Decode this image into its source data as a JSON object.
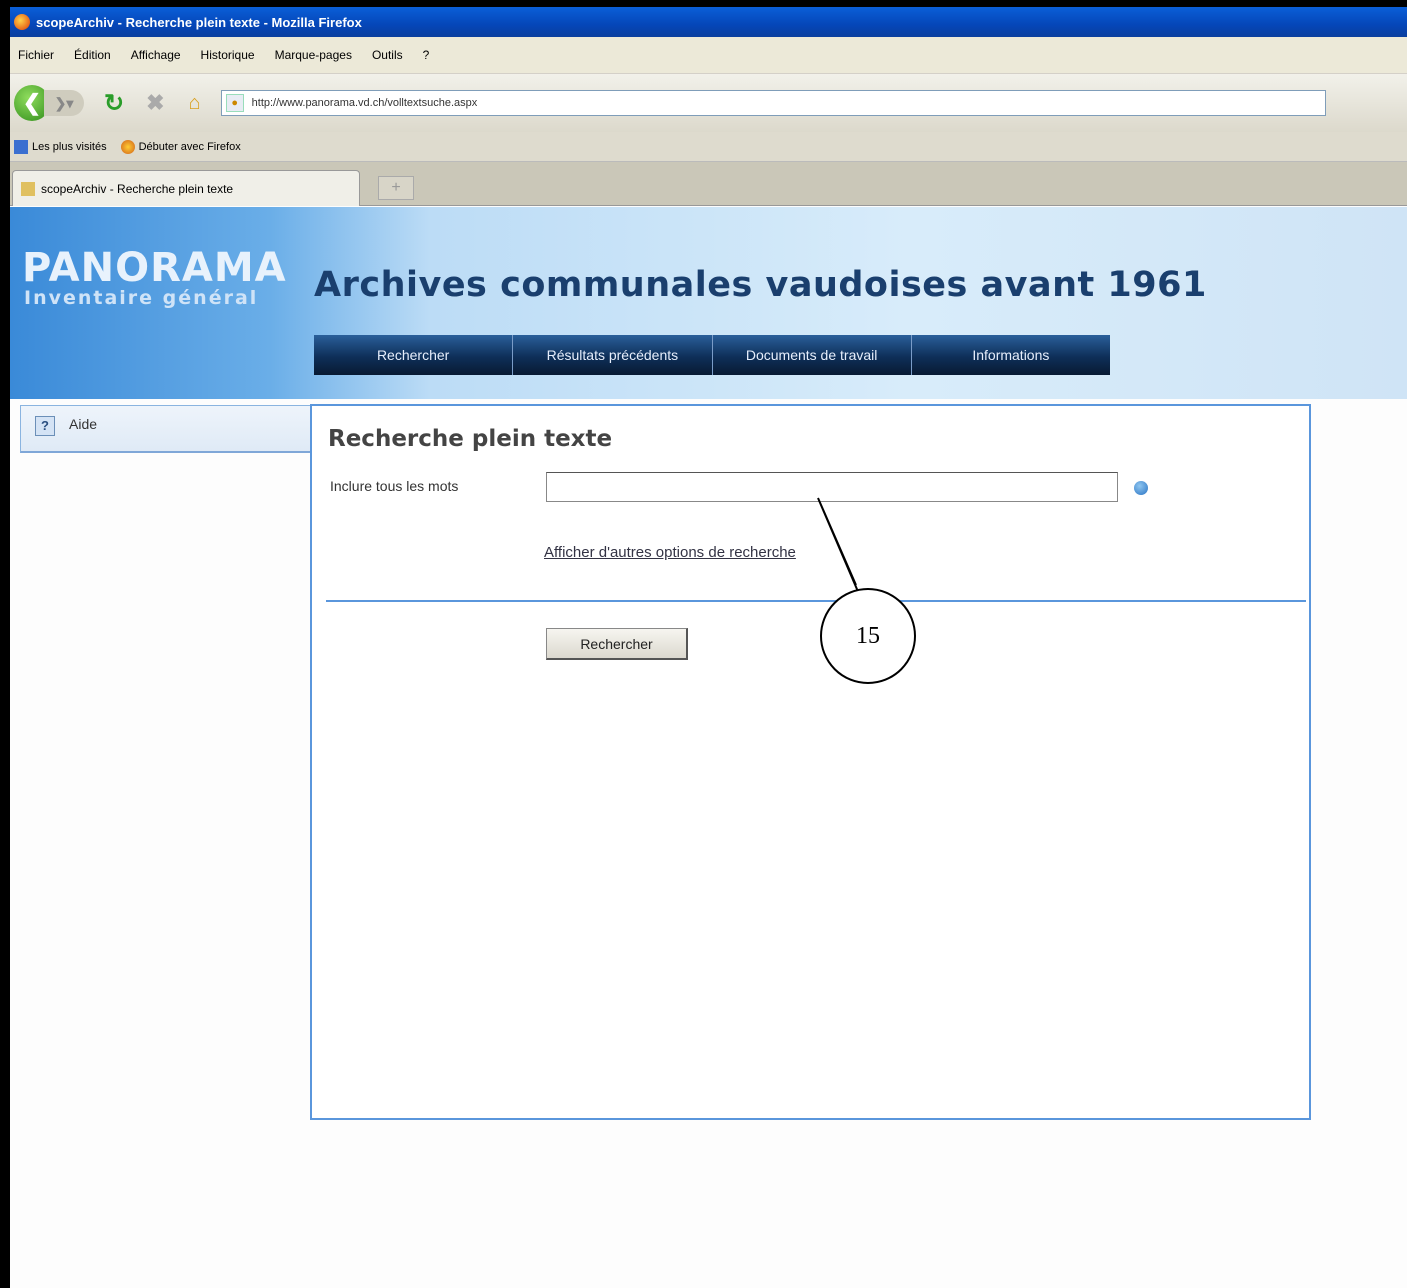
{
  "window": {
    "title": "scopeArchiv - Recherche plein texte - Mozilla Firefox"
  },
  "menu": [
    "Fichier",
    "Édition",
    "Affichage",
    "Historique",
    "Marque-pages",
    "Outils",
    "?"
  ],
  "navbar": {
    "url": "http://www.panorama.vd.ch/volltextsuche.aspx"
  },
  "bookmarks": [
    "Les plus visités",
    "Débuter avec Firefox"
  ],
  "tab": {
    "label": "scopeArchiv - Recherche plein texte",
    "new_tab": "+"
  },
  "header": {
    "logo_title": "PANORAMA",
    "logo_subtitle": "Inventaire général",
    "site_title": "Archives communales vaudoises avant 1961",
    "nav": [
      "Rechercher",
      "Résultats précédents",
      "Documents de travail",
      "Informations"
    ]
  },
  "sidebar": {
    "help_icon": "?",
    "help_label": "Aide"
  },
  "main": {
    "title": "Recherche plein texte",
    "words_label": "Inclure tous les mots",
    "words_value": "",
    "advanced_link": "Afficher d'autres options de recherche",
    "search_button": "Rechercher"
  },
  "annotation": {
    "label": "15"
  },
  "icons": {
    "back": "back-arrow-icon",
    "forward": "forward-arrow-icon",
    "reload": "reload-icon",
    "stop": "stop-icon",
    "home": "home-icon",
    "help": "help-icon",
    "info": "info-icon"
  }
}
